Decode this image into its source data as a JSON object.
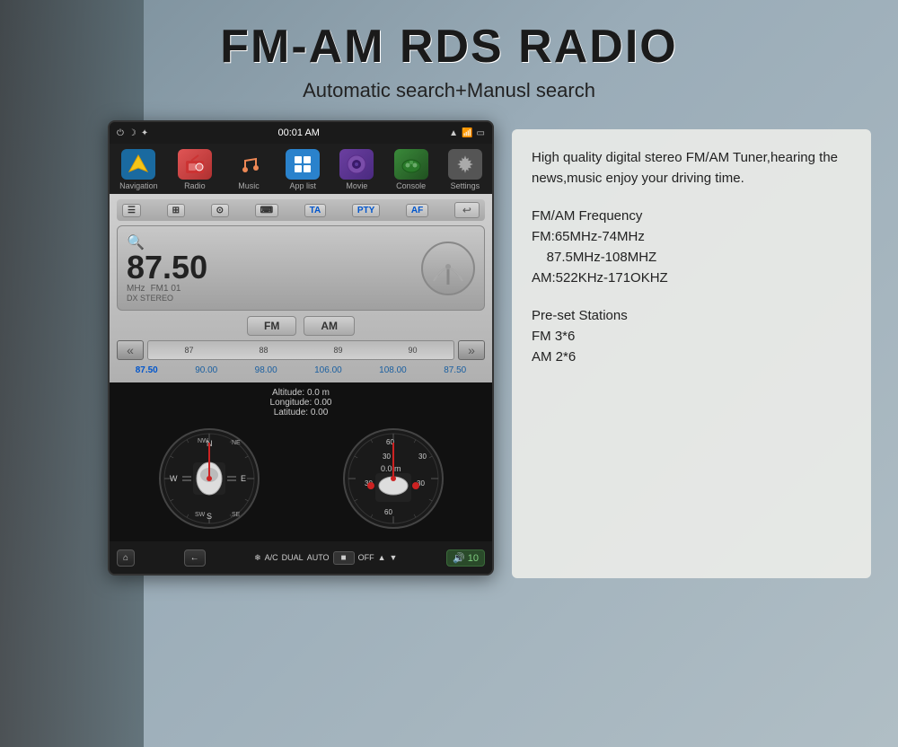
{
  "header": {
    "title": "FM-AM RDS RADIO",
    "subtitle": "Automatic search+Manusl search"
  },
  "device": {
    "statusBar": {
      "time": "00:01 AM",
      "leftIcons": [
        "power",
        "moon",
        "brightness"
      ],
      "rightIcons": [
        "wifi",
        "signal",
        "battery"
      ]
    },
    "navBar": {
      "items": [
        {
          "label": "Navigation",
          "icon": "nav"
        },
        {
          "label": "Radio",
          "icon": "radio"
        },
        {
          "label": "Music",
          "icon": "music"
        },
        {
          "label": "App list",
          "icon": "applist"
        },
        {
          "label": "Movie",
          "icon": "movie"
        },
        {
          "label": "Console",
          "icon": "console"
        },
        {
          "label": "Settings",
          "icon": "settings"
        }
      ]
    },
    "radioPanel": {
      "toolbarButtons": [
        "list",
        "preset",
        "clock",
        "keyboard",
        "TA",
        "PTY",
        "AF"
      ],
      "frequency": "87.50",
      "freqUnit": "MHz",
      "freqStation": "FM1  01",
      "freqLabel": "DX STEREO",
      "fmAmButtons": [
        "FM",
        "AM"
      ],
      "tunerTicks": [
        "87",
        "88",
        "89",
        "90"
      ],
      "presets": [
        "87.50",
        "90.00",
        "98.00",
        "106.00",
        "108.00",
        "87.50"
      ]
    },
    "gpsPanel": {
      "altitude": "Altitude:  0.0 m",
      "longitude": "Longitude:  0.00",
      "latitude": "Latitude:  0.00",
      "speedLabel": "0.0 m"
    },
    "climateBar": {
      "homeBtn": "⌂",
      "backBtn": "←",
      "acLabel": "A/C",
      "dualLabel": "DUAL",
      "autoLabel": "AUTO",
      "offLabel": "OFF",
      "volLabel": "10"
    }
  },
  "infoPanel": {
    "paragraph1": "High quality digital stereo FM/AM Tuner,hearing the news,music enjoy your driving time.",
    "paragraph2": "FM/AM Frequency\nFM:65MHz-74MHz\n    87.5MHz-108MHZ\nAM:522KHz-171OKHZ",
    "paragraph3": "Pre-set Stations\nFM 3*6\nAM 2*6"
  }
}
